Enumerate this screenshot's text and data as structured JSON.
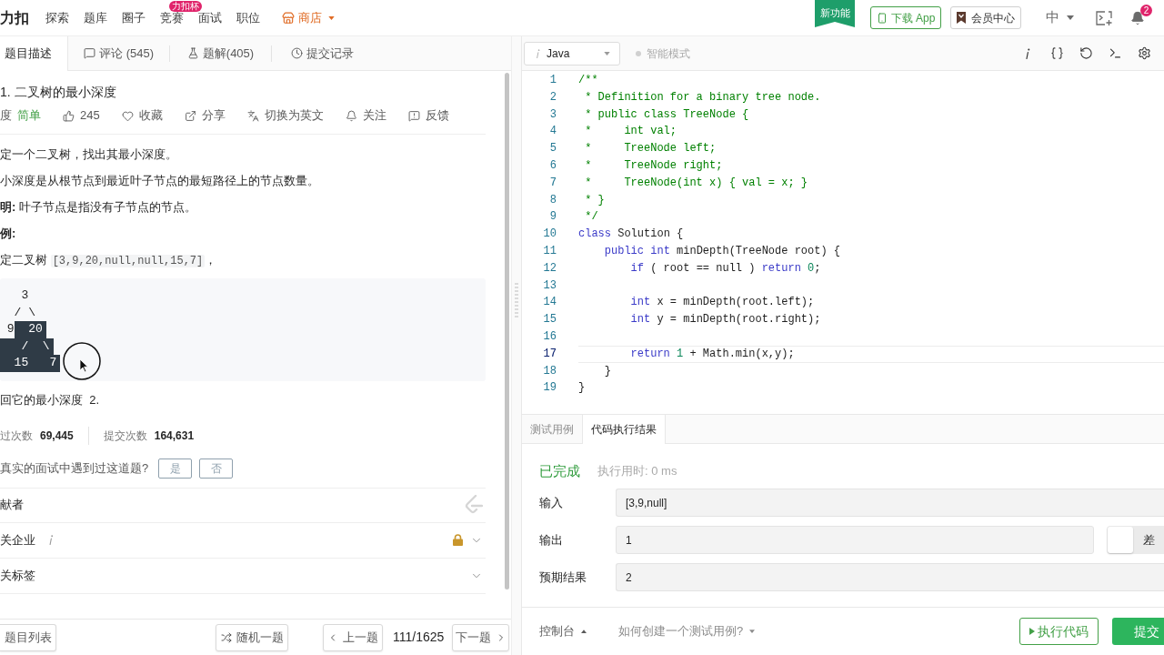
{
  "header": {
    "logo": "力扣",
    "nav": [
      {
        "label": "探索",
        "kind": "link"
      },
      {
        "label": "题库",
        "kind": "link"
      },
      {
        "label": "圈子",
        "kind": "link"
      },
      {
        "label": "竞赛",
        "kind": "link",
        "badge": "力扣杯"
      },
      {
        "label": "面试",
        "kind": "link"
      },
      {
        "label": "职位",
        "kind": "link"
      },
      {
        "label": "商店",
        "kind": "shop"
      }
    ],
    "ribbon": "新功能",
    "download_button": "下载 App",
    "vip_button": "会员中心",
    "language": "中",
    "notification_count": "2"
  },
  "problem_tabs": [
    {
      "label": "题目描述",
      "kind": "description",
      "selected": true
    },
    {
      "label": "评论 (545)",
      "kind": "comments",
      "selected": false
    },
    {
      "label": "题解(405)",
      "kind": "solutions",
      "selected": false
    },
    {
      "label": "提交记录",
      "kind": "submissions",
      "selected": false
    }
  ],
  "problem": {
    "title": "1. 二叉树的最小深度",
    "difficulty_label": "度",
    "difficulty": "简单",
    "actions": [
      {
        "kind": "like",
        "label": "245"
      },
      {
        "kind": "favorite",
        "label": "收藏"
      },
      {
        "kind": "share",
        "label": "分享"
      },
      {
        "kind": "translate",
        "label": "切换为英文"
      },
      {
        "kind": "follow",
        "label": "关注"
      },
      {
        "kind": "feedback",
        "label": "反馈"
      }
    ],
    "paragraphs": [
      {
        "kind": "text",
        "text": "定一个二叉树，找出其最小深度。"
      },
      {
        "kind": "text",
        "text": "小深度是从根节点到最近叶子节点的最短路径上的节点数量。"
      },
      {
        "kind": "text",
        "text": "**明:** 叶子节点是指没有子节点的节点。"
      },
      {
        "kind": "heading",
        "text": "例:"
      },
      {
        "kind": "code",
        "text": "定二叉树 ",
        "code": "[3,9,20,null,null,15,7]",
        "after": "，"
      }
    ],
    "example_tree": [
      [
        {
          "text": "   3",
          "selected": false
        }
      ],
      [
        {
          "text": "  / \\",
          "selected": false
        }
      ],
      [
        {
          "text": " 9",
          "selected": false
        },
        {
          "text": "  20",
          "selected": true
        }
      ],
      [
        {
          "text": "   /  \\",
          "selected": true
        }
      ],
      [
        {
          "text": "  15   7",
          "selected": true
        }
      ]
    ],
    "answer": "回它的最小深度  2.",
    "stats": [
      {
        "label": "过次数",
        "value": "69,445"
      },
      {
        "label": "提交次数",
        "value": "164,631"
      }
    ],
    "interview": {
      "question": "真实的面试中遇到过这道题?",
      "options": [
        "是",
        "否"
      ]
    },
    "sections": [
      {
        "kind": "contributors",
        "label": "献者"
      },
      {
        "kind": "companies",
        "label": "关企业"
      },
      {
        "kind": "tags",
        "label": "关标签"
      }
    ]
  },
  "bottom_nav": {
    "list_button": "题目列表",
    "random_button": "随机一题",
    "prev_button": "上一题",
    "counter": "111/1625",
    "next_button": "下一题"
  },
  "editor": {
    "language": "Java",
    "smart_mode": {
      "label": "智能模式",
      "on": false
    },
    "lines": [
      {
        "number": "1",
        "active": false,
        "tokens": [
          {
            "kind": "comment",
            "text": "/**"
          }
        ]
      },
      {
        "number": "2",
        "active": false,
        "tokens": [
          {
            "kind": "comment",
            "text": " * Definition for a binary tree node."
          }
        ]
      },
      {
        "number": "3",
        "active": false,
        "tokens": [
          {
            "kind": "comment",
            "text": " * public class TreeNode {"
          }
        ]
      },
      {
        "number": "4",
        "active": false,
        "tokens": [
          {
            "kind": "comment",
            "text": " *     int val;"
          }
        ]
      },
      {
        "number": "5",
        "active": false,
        "tokens": [
          {
            "kind": "comment",
            "text": " *     TreeNode left;"
          }
        ]
      },
      {
        "number": "6",
        "active": false,
        "tokens": [
          {
            "kind": "comment",
            "text": " *     TreeNode right;"
          }
        ]
      },
      {
        "number": "7",
        "active": false,
        "tokens": [
          {
            "kind": "comment",
            "text": " *     TreeNode(int x) { val = x; }"
          }
        ]
      },
      {
        "number": "8",
        "active": false,
        "tokens": [
          {
            "kind": "comment",
            "text": " * }"
          }
        ]
      },
      {
        "number": "9",
        "active": false,
        "tokens": [
          {
            "kind": "comment",
            "text": " */"
          }
        ]
      },
      {
        "number": "10",
        "active": false,
        "tokens": [
          {
            "kind": "keyword",
            "text": "class"
          },
          {
            "kind": "plain",
            "text": " Solution {"
          }
        ]
      },
      {
        "number": "11",
        "active": false,
        "tokens": [
          {
            "kind": "keyword",
            "text": "    public"
          },
          {
            "kind": "keyword",
            "text": " int"
          },
          {
            "kind": "plain",
            "text": " minDepth(TreeNode root) {"
          }
        ]
      },
      {
        "number": "12",
        "active": false,
        "tokens": [
          {
            "kind": "keyword",
            "text": "        if"
          },
          {
            "kind": "plain",
            "text": " ( root == null ) "
          },
          {
            "kind": "keyword",
            "text": "return"
          },
          {
            "kind": "number",
            "text": " 0"
          },
          {
            "kind": "plain",
            "text": ";"
          }
        ]
      },
      {
        "number": "13",
        "active": false
      },
      {
        "number": "14",
        "active": false,
        "tokens": [
          {
            "kind": "keyword",
            "text": "        int"
          },
          {
            "kind": "plain",
            "text": " x = minDepth(root.left);"
          }
        ]
      },
      {
        "number": "15",
        "active": false,
        "tokens": [
          {
            "kind": "keyword",
            "text": "        int"
          },
          {
            "kind": "plain",
            "text": " y = minDepth(root.right);"
          }
        ]
      },
      {
        "number": "16",
        "active": false
      },
      {
        "number": "17",
        "active": true,
        "tokens": [
          {
            "kind": "keyword",
            "text": "        return"
          },
          {
            "kind": "number",
            "text": " 1"
          },
          {
            "kind": "plain",
            "text": " + Math.min(x,y);"
          }
        ]
      },
      {
        "number": "18",
        "active": false,
        "tokens": [
          {
            "kind": "plain",
            "text": "    }"
          }
        ]
      },
      {
        "number": "19",
        "active": false,
        "tokens": [
          {
            "kind": "plain",
            "text": "}"
          }
        ]
      }
    ]
  },
  "result": {
    "tabs": [
      {
        "label": "测试用例",
        "selected": false
      },
      {
        "label": "代码执行结果",
        "selected": true
      }
    ],
    "status": "已完成",
    "runtime": "执行用时: 0 ms",
    "rows": [
      {
        "label": "输入",
        "value": "[3,9,null]"
      },
      {
        "label": "输出",
        "value": "1",
        "diff_toggle": {
          "label": "差",
          "on": false
        }
      },
      {
        "label": "预期结果",
        "value": "2"
      }
    ]
  },
  "console_bar": {
    "console": "控制台",
    "help": "如何创建一个测试用例?",
    "run_button": "执行代码",
    "submit_button": "提交"
  }
}
